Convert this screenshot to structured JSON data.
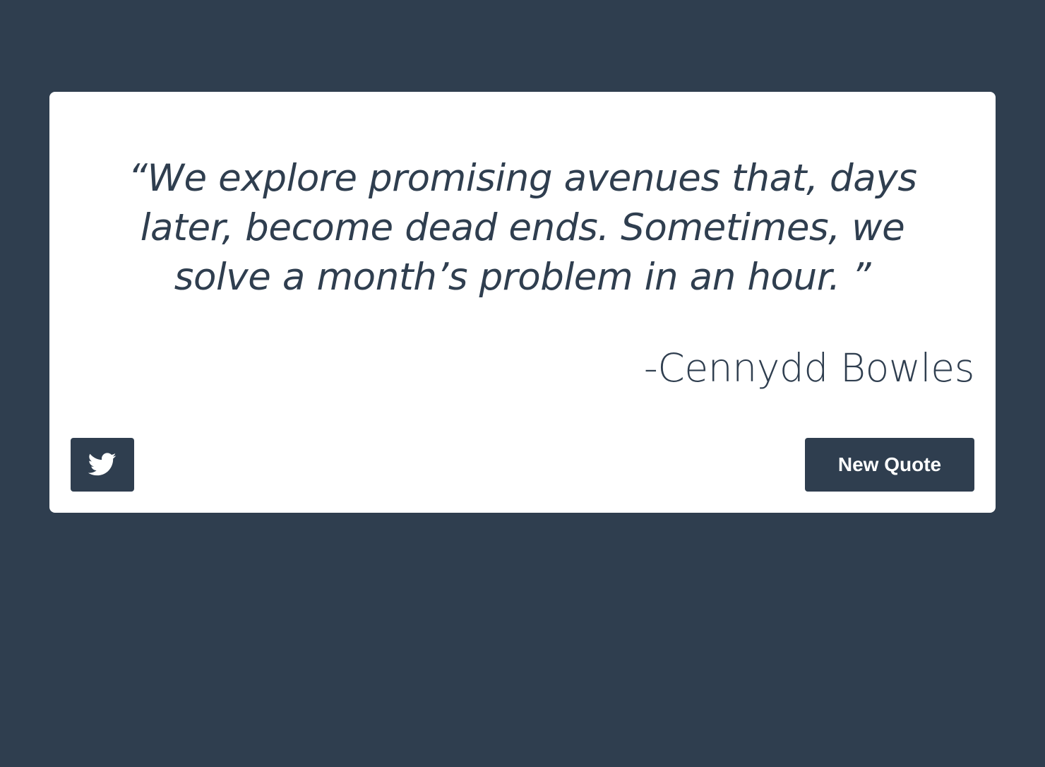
{
  "colors": {
    "background": "#2f3e4f",
    "card": "#ffffff",
    "accent": "#2f3e4f",
    "button_text": "#ffffff"
  },
  "quote": {
    "text": "“We explore promising avenues that, days later, become dead ends. Sometimes, we solve a month’s problem in an hour. ”",
    "author": "-Cennydd Bowles"
  },
  "actions": {
    "tweet_icon": "twitter-bird-icon",
    "new_quote_label": "New Quote"
  }
}
